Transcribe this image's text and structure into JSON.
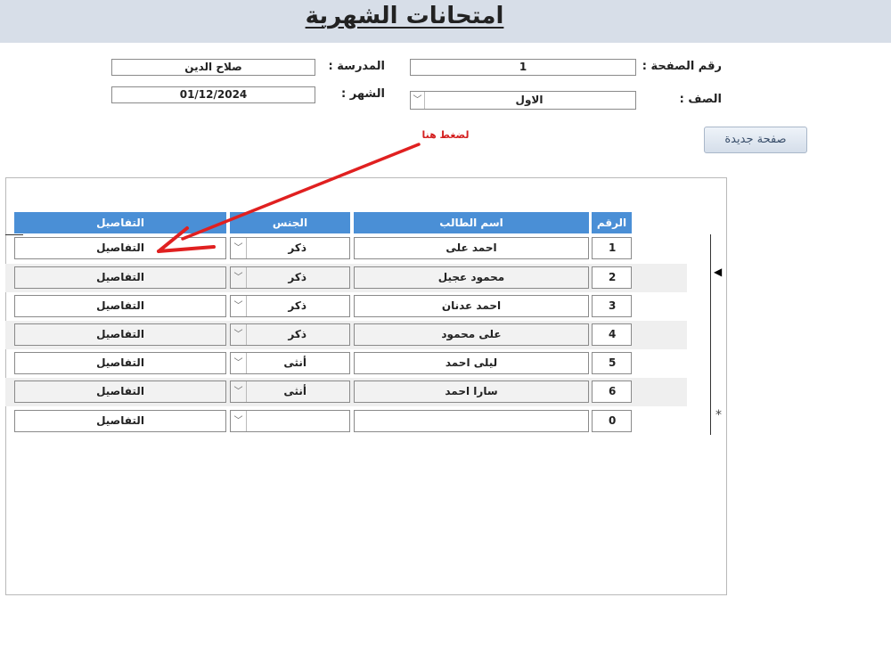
{
  "header": {
    "title": "امتحانات الشهرية"
  },
  "form": {
    "page_number_label": "رقم الصفحة :",
    "page_number_value": "1",
    "school_label": "المدرسة :",
    "school_value": "صلاح الدين",
    "class_label": "الصف :",
    "class_value": "الاول",
    "month_label": "الشهر :",
    "month_value": "01/12/2024",
    "new_page_button": "صفحة جديدة",
    "hint_text": "لضغط هنا"
  },
  "table": {
    "headers": {
      "number": "الرقم",
      "student_name": "اسم الطالب",
      "gender": "الجنس",
      "details": "التفاصيل"
    },
    "rows": [
      {
        "number": "1",
        "name": "احمد على",
        "gender": "ذكر",
        "details": "التفاصيل"
      },
      {
        "number": "2",
        "name": "محمود عجيل",
        "gender": "ذكر",
        "details": "التفاصيل"
      },
      {
        "number": "3",
        "name": "احمد عدنان",
        "gender": "ذكر",
        "details": "التفاصيل"
      },
      {
        "number": "4",
        "name": "على محمود",
        "gender": "ذكر",
        "details": "التفاصيل"
      },
      {
        "number": "5",
        "name": "ليلى احمد",
        "gender": "أنثى",
        "details": "التفاصيل"
      },
      {
        "number": "6",
        "name": "سارا احمد",
        "gender": "أنثى",
        "details": "التفاصيل"
      },
      {
        "number": "0",
        "name": "",
        "gender": "",
        "details": "التفاصيل"
      }
    ],
    "current_record_marker": "◀",
    "new_record_marker": "*"
  },
  "colors": {
    "header_blue": "#4a8fd6",
    "title_bar": "#d7dee8",
    "hint_red": "#d42020",
    "arrow_red": "#e02020"
  }
}
